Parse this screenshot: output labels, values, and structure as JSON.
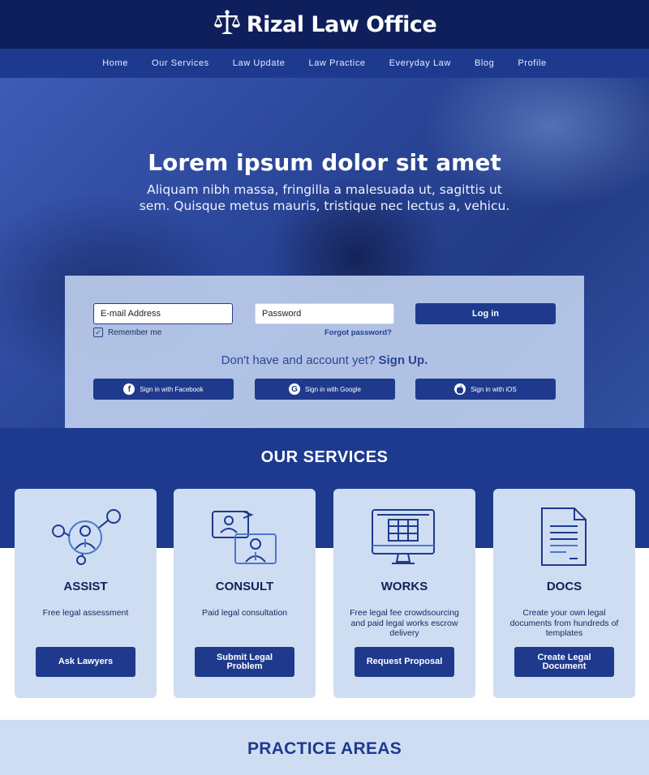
{
  "header": {
    "brand": "Rizal Law Office",
    "logo_icon": "scales-of-justice-icon"
  },
  "nav": {
    "items": [
      "Home",
      "Our Services",
      "Law Update",
      "Law Practice",
      "Everyday Law",
      "Blog",
      "Profile"
    ]
  },
  "hero": {
    "title": "Lorem ipsum dolor sit amet",
    "subtitle": "Aliquam nibh massa, fringilla a malesuada ut, sagittis ut sem. Quisque metus mauris, tristique nec lectus a, vehicu."
  },
  "login": {
    "email_placeholder": "E-mail Address",
    "password_placeholder": "Password",
    "login_label": "Log in",
    "remember_label": "Remember me",
    "remember_checked": true,
    "forgot_label": "Forgot password?",
    "signup_prompt": "Don't have and account yet?",
    "signup_link": "Sign Up.",
    "social": [
      {
        "label": "Sign in with Facebook",
        "icon": "facebook-icon"
      },
      {
        "label": "Sign in with Google",
        "icon": "google-icon"
      },
      {
        "label": "Sign in with iOS",
        "icon": "apple-icon"
      }
    ]
  },
  "services": {
    "title": "OUR SERVICES",
    "cards": [
      {
        "title": "ASSIST",
        "desc": "Free legal assessment",
        "button": "Ask Lawyers",
        "icon": "network-person-icon"
      },
      {
        "title": "CONSULT",
        "desc": "Paid legal consultation",
        "button": "Submit Legal Problem",
        "icon": "video-consult-icon"
      },
      {
        "title": "WORKS",
        "desc": "Free legal fee crowdsourcing and paid legal works escrow delivery",
        "button": "Request Proposal",
        "icon": "monitor-calendar-icon"
      },
      {
        "title": "DOCS",
        "desc": "Create your own legal documents from hundreds of templates",
        "button": "Create Legal Document",
        "icon": "document-icon"
      }
    ]
  },
  "practice": {
    "title": "PRACTICE AREAS"
  },
  "colors": {
    "navy": "#0f1f5c",
    "primary": "#1e3a8f",
    "light_blue": "#cfddf2"
  }
}
